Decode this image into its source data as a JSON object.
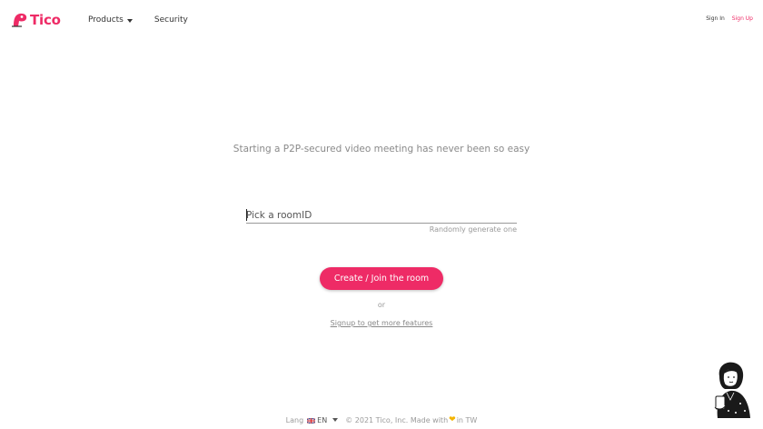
{
  "header": {
    "logo_text": "Tico",
    "nav": {
      "products_label": "Products",
      "security_label": "Security"
    },
    "auth": {
      "signin_label": "Sign In",
      "signup_label": "Sign Up"
    }
  },
  "main": {
    "tagline": "Starting a P2P-secured video meeting has never been so easy",
    "room_input": {
      "placeholder": "Pick a roomID",
      "value": ""
    },
    "random_label": "Randomly generate one",
    "cta_label": "Create / Join the room",
    "or_label": "or",
    "signup_link_label": "Signup to get more features"
  },
  "footer": {
    "lang_label": "Lang",
    "lang_code": "EN",
    "copyright_before": "© 2021 Tico, Inc. Made with",
    "copyright_after": "in TW"
  },
  "icons": {
    "logo": "tico-logo-icon",
    "products_caret": "chevron-down-icon",
    "flag": "uk-flag-icon",
    "lang_caret": "chevron-down-icon",
    "heart": "yellow-heart-icon",
    "mascot": "person-illustration"
  },
  "colors": {
    "accent": "#ee2b66",
    "muted_text": "#8a8a8a",
    "heart": "#f4b400"
  }
}
